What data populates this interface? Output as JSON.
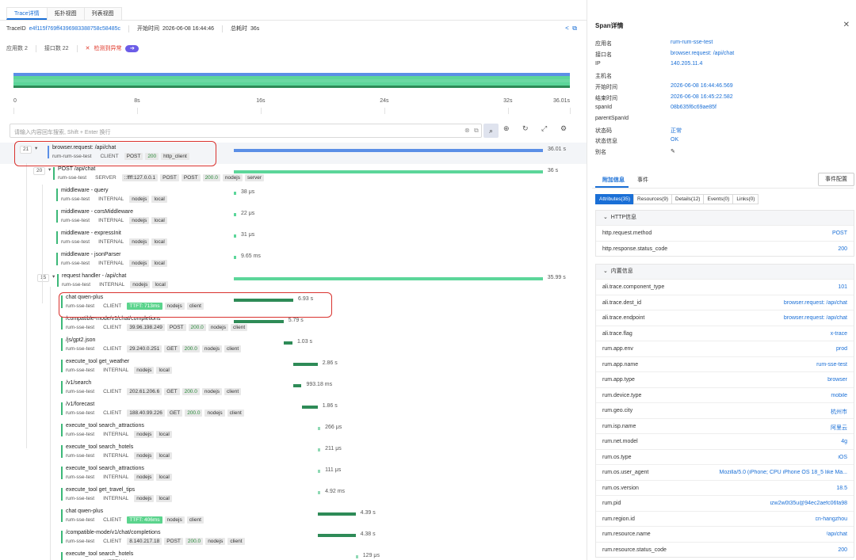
{
  "tabs": [
    "Trace详情",
    "拓扑视图",
    "列表视图"
  ],
  "trace": {
    "id_label": "TraceID",
    "id": "e4f115f769ff4396983388758c58485c",
    "start_label": "开始时间",
    "start": "2026-06-08 16:44:46",
    "total_label": "总耗时",
    "total": "36s"
  },
  "stats": {
    "apps": "应用数 2",
    "interfaces": "接口数 22",
    "anomaly": "检测到异常"
  },
  "axis_ticks": [
    "0",
    "8s",
    "16s",
    "24s",
    "32s",
    "36.01s"
  ],
  "search": {
    "placeholder": "请输入内容回车搜索, Shift + Enter 换行"
  },
  "colors": {
    "accent": "#1a6fd6",
    "span_green": "#5cd69a",
    "span_dark": "#2e8b57",
    "root_blue": "#5b8fe6",
    "highlight": "#d9322e"
  },
  "rows": [
    {
      "count": "21",
      "name": "browser.request: /api/chat",
      "app": "rum-rum-sse-test",
      "kind": "CLIENT",
      "tags": [
        "POST",
        "200",
        "http_client"
      ],
      "dur": "36.01 s",
      "start": 0,
      "len": 36.01
    },
    {
      "count": "20",
      "name": "POST /api/chat",
      "app": "rum-sse-test",
      "kind": "SERVER",
      "tags": [
        "::ffff:127.0.0.1",
        "POST",
        "POST",
        "200.0",
        "nodejs",
        "server"
      ],
      "dur": "36 s",
      "start": 0,
      "len": 36
    },
    {
      "name": "middleware - query",
      "app": "rum-sse-test",
      "kind": "INTERNAL",
      "tags": [
        "nodejs",
        "local"
      ],
      "dur": "38 μs",
      "start": 0,
      "len": 0.02
    },
    {
      "name": "middleware - corsMiddleware",
      "app": "rum-sse-test",
      "kind": "INTERNAL",
      "tags": [
        "nodejs",
        "local"
      ],
      "dur": "22 μs",
      "start": 0,
      "len": 0.02
    },
    {
      "name": "middleware - expressInit",
      "app": "rum-sse-test",
      "kind": "INTERNAL",
      "tags": [
        "nodejs",
        "local"
      ],
      "dur": "31 μs",
      "start": 0,
      "len": 0.02
    },
    {
      "name": "middleware - jsonParser",
      "app": "rum-sse-test",
      "kind": "INTERNAL",
      "tags": [
        "nodejs",
        "local"
      ],
      "dur": "9.65 ms",
      "start": 0,
      "len": 0.02
    },
    {
      "count": "15",
      "name": "request handler - /api/chat",
      "app": "rum-sse-test",
      "kind": "INTERNAL",
      "tags": [
        "nodejs",
        "local"
      ],
      "dur": "35.99 s",
      "start": 0,
      "len": 35.99
    },
    {
      "name": "chat qwen-plus",
      "app": "rum-sse-test",
      "kind": "CLIENT",
      "tags": [
        "TTFT: 713ms",
        "nodejs",
        "client"
      ],
      "dur": "6.93 s",
      "start": 0,
      "len": 6.93
    },
    {
      "name": "/compatible-mode/v1/chat/completions",
      "app": "rum-sse-test",
      "kind": "CLIENT",
      "tags": [
        "39.96.198.249",
        "POST",
        "200.0",
        "nodejs",
        "client"
      ],
      "dur": "5.79 s",
      "start": 0,
      "len": 5.79
    },
    {
      "name": "/js/gpt2.json",
      "app": "rum-sse-test",
      "kind": "CLIENT",
      "tags": [
        "29.240.0.251",
        "GET",
        "200.0",
        "nodejs",
        "client"
      ],
      "dur": "1.03 s",
      "start": 5.8,
      "len": 1.03
    },
    {
      "name": "execute_tool get_weather",
      "app": "rum-sse-test",
      "kind": "INTERNAL",
      "tags": [
        "nodejs",
        "local"
      ],
      "dur": "2.86 s",
      "start": 6.9,
      "len": 2.86
    },
    {
      "name": "/v1/search",
      "app": "rum-sse-test",
      "kind": "CLIENT",
      "tags": [
        "202.61.206.6",
        "GET",
        "200.0",
        "nodejs",
        "client"
      ],
      "dur": "993.18 ms",
      "start": 6.9,
      "len": 0.99
    },
    {
      "name": "/v1/forecast",
      "app": "rum-sse-test",
      "kind": "CLIENT",
      "tags": [
        "188.40.99.226",
        "GET",
        "200.0",
        "nodejs",
        "client"
      ],
      "dur": "1.86 s",
      "start": 7.9,
      "len": 1.86
    },
    {
      "name": "execute_tool search_attractions",
      "app": "rum-sse-test",
      "kind": "INTERNAL",
      "tags": [
        "nodejs",
        "local"
      ],
      "dur": "266 μs",
      "start": 9.8,
      "len": 0.02
    },
    {
      "name": "execute_tool search_hotels",
      "app": "rum-sse-test",
      "kind": "INTERNAL",
      "tags": [
        "nodejs",
        "local"
      ],
      "dur": "211 μs",
      "start": 9.8,
      "len": 0.02
    },
    {
      "name": "execute_tool search_attractions",
      "app": "rum-sse-test",
      "kind": "INTERNAL",
      "tags": [
        "nodejs",
        "local"
      ],
      "dur": "111 μs",
      "start": 9.8,
      "len": 0.02
    },
    {
      "name": "execute_tool get_travel_tips",
      "app": "rum-sse-test",
      "kind": "INTERNAL",
      "tags": [
        "nodejs",
        "local"
      ],
      "dur": "4.92 ms",
      "start": 9.8,
      "len": 0.02
    },
    {
      "name": "chat qwen-plus",
      "app": "rum-sse-test",
      "kind": "CLIENT",
      "tags": [
        "TTFT: 406ms",
        "nodejs",
        "client"
      ],
      "dur": "4.39 s",
      "start": 9.8,
      "len": 4.39
    },
    {
      "name": "/compatible-mode/v1/chat/completions",
      "app": "rum-sse-test",
      "kind": "CLIENT",
      "tags": [
        "8.140.217.18",
        "POST",
        "200.0",
        "nodejs",
        "client"
      ],
      "dur": "4.38 s",
      "start": 9.8,
      "len": 4.38
    },
    {
      "name": "execute_tool search_hotels",
      "app": "rum-sse-test",
      "kind": "INTERNAL",
      "tags": [],
      "dur": "129 μs",
      "start": 14.2,
      "len": 0.02
    }
  ],
  "panel": {
    "title": "Span详情",
    "fields": [
      {
        "k": "应用名",
        "v": "rum-rum-sse-test"
      },
      {
        "k": "接口名",
        "v": "browser.request: /api/chat"
      },
      {
        "k": "IP",
        "v": "140.205.11.4"
      },
      {
        "k": "主机名",
        "v": ""
      },
      {
        "k": "开始时间",
        "v": "2026-06-08 16:44:46.569"
      },
      {
        "k": "结束时间",
        "v": "2026-06-08 16:45:22.582"
      },
      {
        "k": "spanId",
        "v": "08b635f6c69ae85f"
      },
      {
        "k": "parentSpanId",
        "v": ""
      },
      {
        "k": "状态码",
        "v": "正常"
      },
      {
        "k": "状态信息",
        "v": "OK"
      },
      {
        "k": "别名",
        "v": "✎"
      }
    ],
    "subtabs": [
      "附加信息",
      "事件"
    ],
    "config_btn": "事件配置",
    "segments": [
      "Attributes(35)",
      "Resources(9)",
      "Details(12)",
      "Events(0)",
      "Links(0)"
    ],
    "http_title": "HTTP信息",
    "http": [
      {
        "k": "http.request.method",
        "v": "POST"
      },
      {
        "k": "http.response.status_code",
        "v": "200"
      }
    ],
    "builtin_title": "内置信息",
    "builtin": [
      {
        "k": "ali.trace.component_type",
        "v": "101"
      },
      {
        "k": "ali.trace.dest_id",
        "v": "browser.request: /api/chat"
      },
      {
        "k": "ali.trace.endpoint",
        "v": "browser.request: /api/chat"
      },
      {
        "k": "ali.trace.flag",
        "v": "x-trace"
      },
      {
        "k": "rum.app.env",
        "v": "prod"
      },
      {
        "k": "rum.app.name",
        "v": "rum-sse-test"
      },
      {
        "k": "rum.app.type",
        "v": "browser"
      },
      {
        "k": "rum.device.type",
        "v": "mobile"
      },
      {
        "k": "rum.geo.city",
        "v": "杭州市"
      },
      {
        "k": "rum.isp.name",
        "v": "阿里云"
      },
      {
        "k": "rum.net.model",
        "v": "4g"
      },
      {
        "k": "rum.os.type",
        "v": "iOS"
      },
      {
        "k": "rum.os.user_agent",
        "v": "Mozilla/5.0 (iPhone; CPU iPhone OS 18_5 like Ma..."
      },
      {
        "k": "rum.os.version",
        "v": "18.5"
      },
      {
        "k": "rum.pid",
        "v": "izw2w0t35u@94ec2aefc06fa98"
      },
      {
        "k": "rum.region.id",
        "v": "cn-hangzhou"
      },
      {
        "k": "rum.resource.name",
        "v": "/api/chat"
      },
      {
        "k": "rum.resource.status_code",
        "v": "200"
      }
    ]
  }
}
